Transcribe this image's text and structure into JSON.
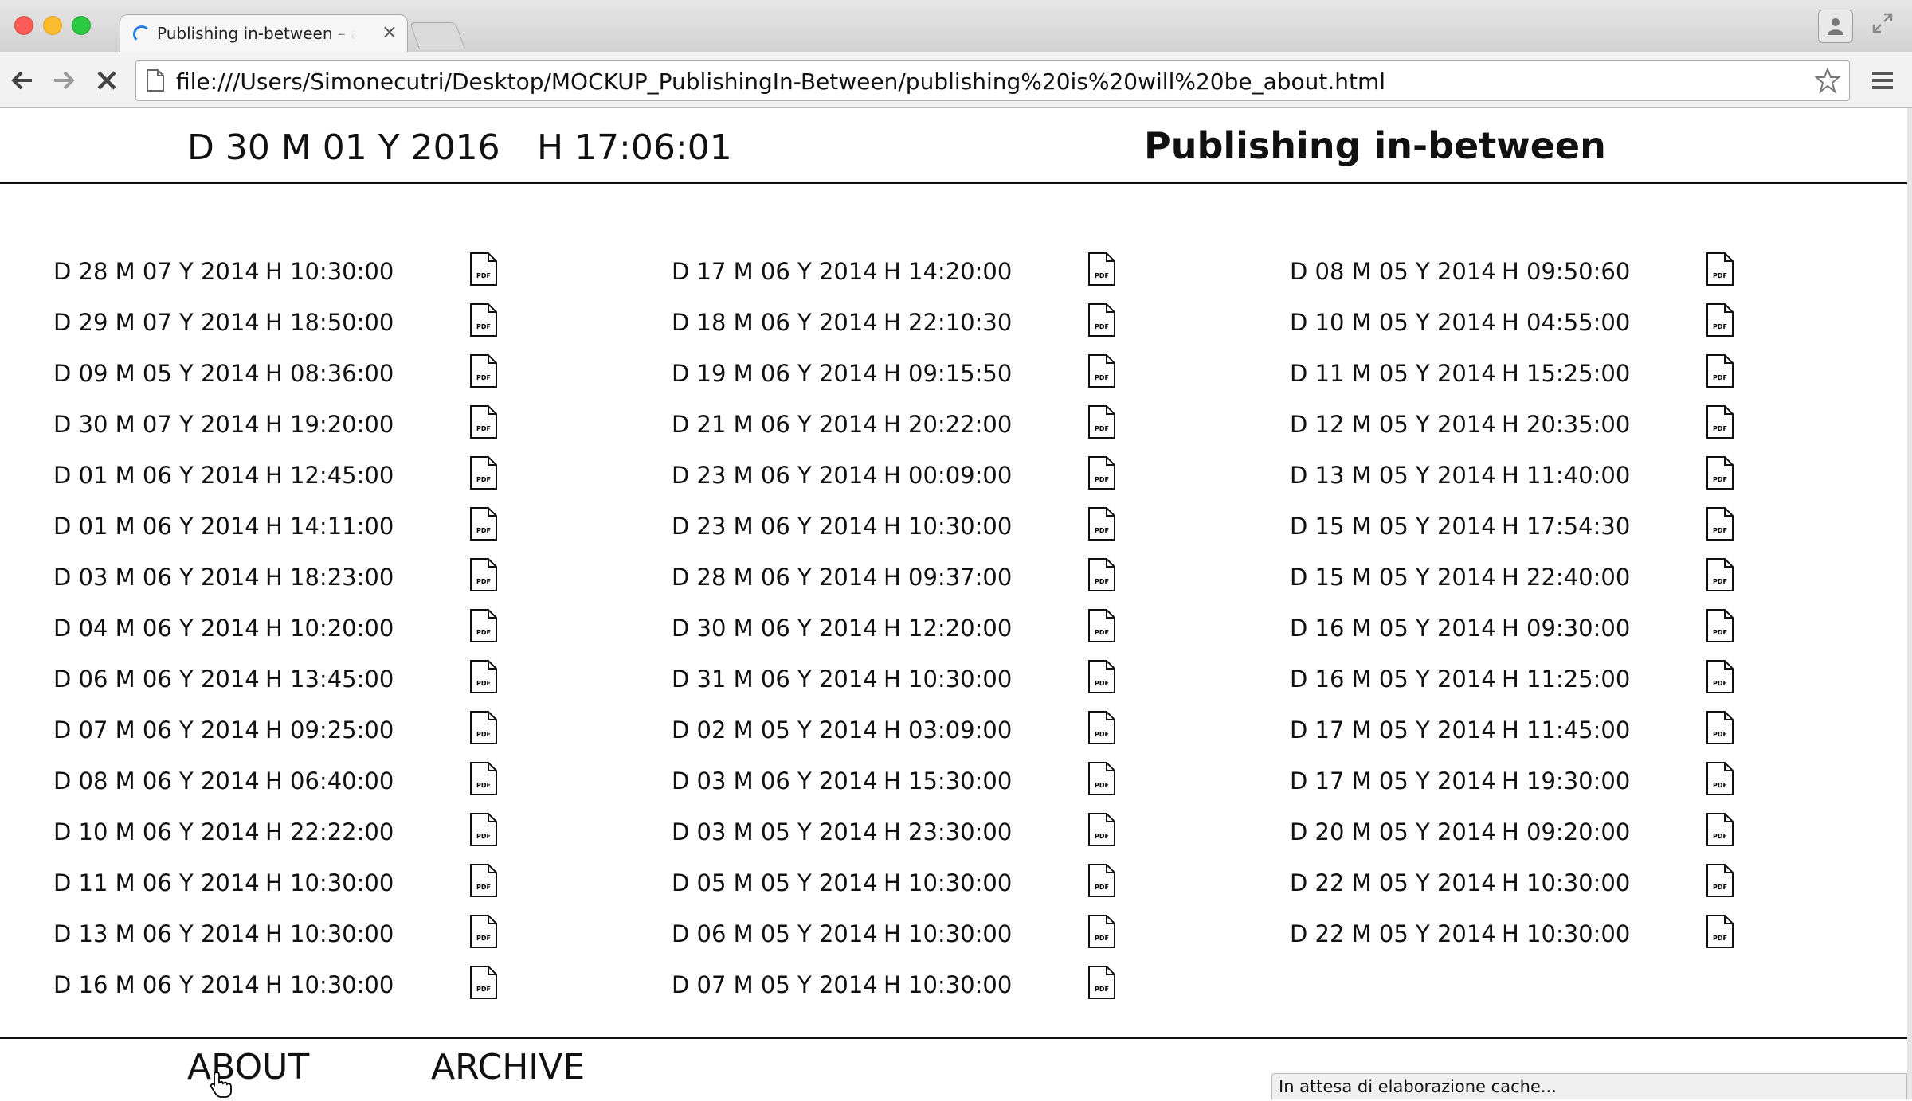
{
  "browser": {
    "tab_title": "Publishing in-between – about",
    "url": "file:///Users/Simonecutri/Desktop/MOCKUP_PublishingIn-Between/publishing%20is%20will%20be_about.html",
    "status": "In attesa di elaborazione cache..."
  },
  "header": {
    "date": "D 30 M 01 Y 2016",
    "time": "H 17:06:01",
    "title": "Publishing in-between"
  },
  "columns": [
    [
      {
        "date": "D 28 M 07 Y 2014",
        "time": "H 10:30:00"
      },
      {
        "date": "D 29 M 07 Y 2014",
        "time": "H 18:50:00"
      },
      {
        "date": "D 09 M 05 Y 2014",
        "time": "H 08:36:00"
      },
      {
        "date": "D 30 M 07 Y 2014",
        "time": "H 19:20:00"
      },
      {
        "date": "D 01 M 06 Y 2014",
        "time": "H 12:45:00"
      },
      {
        "date": "D 01 M 06 Y 2014",
        "time": "H 14:11:00"
      },
      {
        "date": "D 03 M 06 Y 2014",
        "time": "H 18:23:00"
      },
      {
        "date": "D 04 M 06 Y 2014",
        "time": "H 10:20:00"
      },
      {
        "date": "D 06 M 06 Y 2014",
        "time": "H 13:45:00"
      },
      {
        "date": "D 07 M 06 Y 2014",
        "time": "H 09:25:00"
      },
      {
        "date": "D 08 M 06 Y 2014",
        "time": "H 06:40:00"
      },
      {
        "date": "D 10 M 06 Y 2014",
        "time": "H 22:22:00"
      },
      {
        "date": "D 11 M 06 Y 2014",
        "time": "H 10:30:00"
      },
      {
        "date": "D 13 M 06 Y 2014",
        "time": "H 10:30:00"
      },
      {
        "date": "D 16 M 06 Y 2014",
        "time": "H 10:30:00"
      }
    ],
    [
      {
        "date": "D 17 M 06 Y 2014",
        "time": "H 14:20:00"
      },
      {
        "date": "D 18 M 06 Y 2014",
        "time": "H 22:10:30"
      },
      {
        "date": "D 19 M 06 Y 2014",
        "time": "H 09:15:50"
      },
      {
        "date": "D 21 M 06 Y 2014",
        "time": "H 20:22:00"
      },
      {
        "date": "D 23 M 06 Y 2014",
        "time": "H 00:09:00"
      },
      {
        "date": "D 23 M 06 Y 2014",
        "time": "H 10:30:00"
      },
      {
        "date": "D 28 M 06 Y 2014",
        "time": "H 09:37:00"
      },
      {
        "date": "D 30 M 06 Y 2014",
        "time": "H 12:20:00"
      },
      {
        "date": "D 31 M 06 Y 2014",
        "time": "H 10:30:00"
      },
      {
        "date": "D 02 M 05 Y 2014",
        "time": "H 03:09:00"
      },
      {
        "date": "D 03 M 06 Y 2014",
        "time": "H 15:30:00"
      },
      {
        "date": "D 03 M 05 Y 2014",
        "time": "H 23:30:00"
      },
      {
        "date": "D 05 M 05 Y 2014",
        "time": "H 10:30:00"
      },
      {
        "date": "D 06 M 05 Y 2014",
        "time": "H 10:30:00"
      },
      {
        "date": "D 07 M 05 Y 2014",
        "time": "H 10:30:00"
      }
    ],
    [
      {
        "date": "D 08 M 05 Y 2014",
        "time": "H 09:50:60"
      },
      {
        "date": "D 10 M 05 Y 2014",
        "time": "H 04:55:00"
      },
      {
        "date": "D 11 M 05 Y 2014",
        "time": "H 15:25:00"
      },
      {
        "date": "D 12 M 05 Y 2014",
        "time": "H 20:35:00"
      },
      {
        "date": "D 13 M 05 Y 2014",
        "time": "H 11:40:00"
      },
      {
        "date": "D 15 M 05 Y 2014",
        "time": "H 17:54:30"
      },
      {
        "date": "D 15 M 05 Y 2014",
        "time": "H 22:40:00"
      },
      {
        "date": "D 16 M 05 Y 2014",
        "time": "H 09:30:00"
      },
      {
        "date": "D 16 M 05 Y 2014",
        "time": "H 11:25:00"
      },
      {
        "date": "D 17 M 05 Y 2014",
        "time": "H 11:45:00"
      },
      {
        "date": "D 17 M 05 Y 2014",
        "time": "H 19:30:00"
      },
      {
        "date": "D 20 M 05 Y 2014",
        "time": "H 09:20:00"
      },
      {
        "date": "D 22 M 05 Y 2014",
        "time": "H 10:30:00"
      },
      {
        "date": "D 22 M 05 Y 2014",
        "time": "H 10:30:00"
      }
    ]
  ],
  "file_icon": {
    "name": "pdf-file-icon",
    "label": "PDF"
  },
  "footer": {
    "about": "ABOUT",
    "archive": "ARCHIVE"
  }
}
